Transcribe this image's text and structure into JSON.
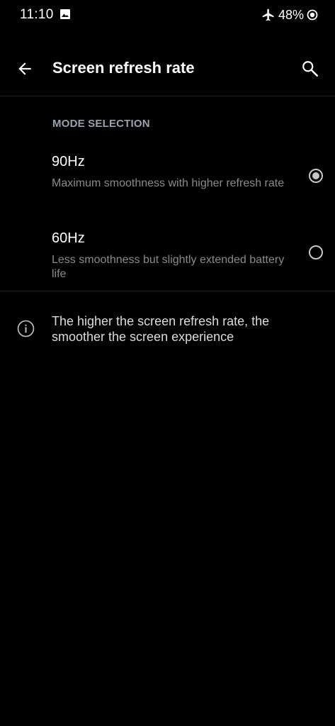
{
  "status_bar": {
    "time": "11:10",
    "battery": "48%",
    "icons": [
      "image-icon",
      "airplane-icon",
      "battery-icon"
    ]
  },
  "app_bar": {
    "title": "Screen refresh rate",
    "back_icon": "back-arrow-icon",
    "search_icon": "search-icon"
  },
  "section": {
    "header": "MODE SELECTION"
  },
  "options": [
    {
      "title": "90Hz",
      "description": "Maximum smoothness with higher refresh rate",
      "selected": true
    },
    {
      "title": "60Hz",
      "description": "Less smoothness but slightly extended battery life",
      "selected": false
    }
  ],
  "info": {
    "icon": "info-icon",
    "text": "The higher the screen refresh rate, the smoother the screen experience"
  },
  "colors": {
    "background": "#000000",
    "text_primary": "#ffffff",
    "text_secondary": "#8a8a8a",
    "section_header": "#9aa3ad",
    "radio": "#c6c6c6"
  }
}
